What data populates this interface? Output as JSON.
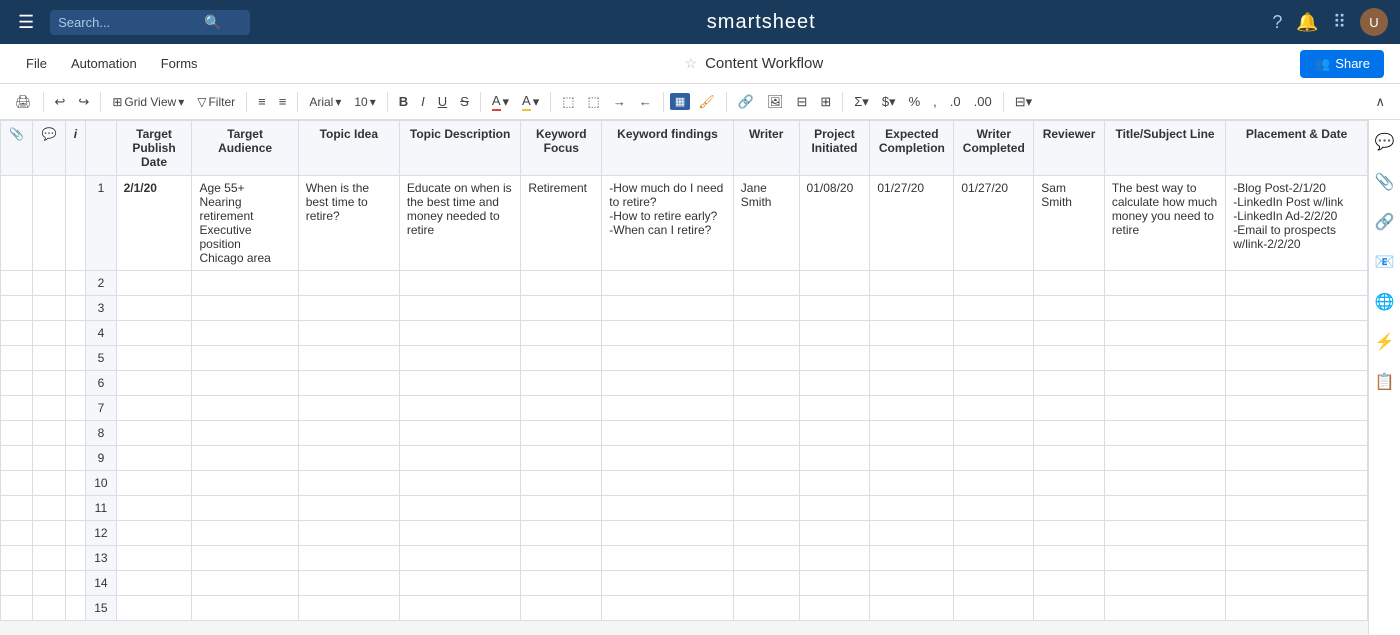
{
  "nav": {
    "search_placeholder": "Search...",
    "title": "smartsheet",
    "icons": [
      "?",
      "🔔",
      "⠿"
    ],
    "hamburger": "☰"
  },
  "second_bar": {
    "menu_items": [
      "File",
      "Automation",
      "Forms"
    ],
    "sheet_title": "Content Workflow",
    "share_label": "Share"
  },
  "toolbar": {
    "grid_view_label": "Grid View",
    "filter_label": "Filter",
    "font_label": "Arial",
    "size_label": "10",
    "bold": "B",
    "italic": "I",
    "underline": "U",
    "strikethrough": "S"
  },
  "columns": [
    {
      "id": "target_publish_date",
      "label": "Target Publish Date"
    },
    {
      "id": "target_audience",
      "label": "Target Audience"
    },
    {
      "id": "topic_idea",
      "label": "Topic Idea"
    },
    {
      "id": "topic_description",
      "label": "Topic Description"
    },
    {
      "id": "keyword_focus",
      "label": "Keyword Focus"
    },
    {
      "id": "keyword_findings",
      "label": "Keyword findings"
    },
    {
      "id": "writer",
      "label": "Writer"
    },
    {
      "id": "project_initiated",
      "label": "Project Initiated"
    },
    {
      "id": "expected_completion",
      "label": "Expected Completion"
    },
    {
      "id": "writer_completed",
      "label": "Writer Completed"
    },
    {
      "id": "reviewer",
      "label": "Reviewer"
    },
    {
      "id": "title_subject",
      "label": "Title/Subject Line"
    },
    {
      "id": "placement_date",
      "label": "Placement & Date"
    }
  ],
  "rows": [
    {
      "num": 1,
      "target_publish_date": "2/1/20",
      "target_audience": "Age 55+\nNearing retirement\nExecutive position\nChicago area",
      "topic_idea": "When is the best time to retire?",
      "topic_description": "Educate on when is the best time and money needed to retire",
      "keyword_focus": "Retirement",
      "keyword_findings": "-How much do I need to retire?\n-How to retire early?\n-When can I retire?",
      "writer": "Jane Smith",
      "project_initiated": "01/08/20",
      "expected_completion": "01/27/20",
      "writer_completed": "01/27/20",
      "reviewer": "Sam Smith",
      "title_subject": "The best way to calculate how much money you need to retire",
      "placement_date": "-Blog Post-2/1/20\n-LinkedIn Post w/link\n-LinkedIn Ad-2/2/20\n-Email to prospects w/link-2/2/20"
    },
    {
      "num": 2,
      "target_publish_date": "",
      "target_audience": "",
      "topic_idea": "",
      "topic_description": "",
      "keyword_focus": "",
      "keyword_findings": "",
      "writer": "",
      "project_initiated": "",
      "expected_completion": "",
      "writer_completed": "",
      "reviewer": "",
      "title_subject": "",
      "placement_date": ""
    },
    {
      "num": 3,
      "target_publish_date": "",
      "target_audience": "",
      "topic_idea": "",
      "topic_description": "",
      "keyword_focus": "",
      "keyword_findings": "",
      "writer": "",
      "project_initiated": "",
      "expected_completion": "",
      "writer_completed": "",
      "reviewer": "",
      "title_subject": "",
      "placement_date": ""
    },
    {
      "num": 4,
      "target_publish_date": "",
      "target_audience": "",
      "topic_idea": "",
      "topic_description": "",
      "keyword_focus": "",
      "keyword_findings": "",
      "writer": "",
      "project_initiated": "",
      "expected_completion": "",
      "writer_completed": "",
      "reviewer": "",
      "title_subject": "",
      "placement_date": ""
    },
    {
      "num": 5,
      "target_publish_date": "",
      "target_audience": "",
      "topic_idea": "",
      "topic_description": "",
      "keyword_focus": "",
      "keyword_findings": "",
      "writer": "",
      "project_initiated": "",
      "expected_completion": "",
      "writer_completed": "",
      "reviewer": "",
      "title_subject": "",
      "placement_date": ""
    },
    {
      "num": 6,
      "target_publish_date": "",
      "target_audience": "",
      "topic_idea": "",
      "topic_description": "",
      "keyword_focus": "",
      "keyword_findings": "",
      "writer": "",
      "project_initiated": "",
      "expected_completion": "",
      "writer_completed": "",
      "reviewer": "",
      "title_subject": "",
      "placement_date": ""
    },
    {
      "num": 7,
      "target_publish_date": "",
      "target_audience": "",
      "topic_idea": "",
      "topic_description": "",
      "keyword_focus": "",
      "keyword_findings": "",
      "writer": "",
      "project_initiated": "",
      "expected_completion": "",
      "writer_completed": "",
      "reviewer": "",
      "title_subject": "",
      "placement_date": ""
    },
    {
      "num": 8,
      "target_publish_date": "",
      "target_audience": "",
      "topic_idea": "",
      "topic_description": "",
      "keyword_focus": "",
      "keyword_findings": "",
      "writer": "",
      "project_initiated": "",
      "expected_completion": "",
      "writer_completed": "",
      "reviewer": "",
      "title_subject": "",
      "placement_date": ""
    },
    {
      "num": 9,
      "target_publish_date": "",
      "target_audience": "",
      "topic_idea": "",
      "topic_description": "",
      "keyword_focus": "",
      "keyword_findings": "",
      "writer": "",
      "project_initiated": "",
      "expected_completion": "",
      "writer_completed": "",
      "reviewer": "",
      "title_subject": "",
      "placement_date": ""
    },
    {
      "num": 10,
      "target_publish_date": "",
      "target_audience": "",
      "topic_idea": "",
      "topic_description": "",
      "keyword_focus": "",
      "keyword_findings": "",
      "writer": "",
      "project_initiated": "",
      "expected_completion": "",
      "writer_completed": "",
      "reviewer": "",
      "title_subject": "",
      "placement_date": ""
    },
    {
      "num": 11,
      "target_publish_date": "",
      "target_audience": "",
      "topic_idea": "",
      "topic_description": "",
      "keyword_focus": "",
      "keyword_findings": "",
      "writer": "",
      "project_initiated": "",
      "expected_completion": "",
      "writer_completed": "",
      "reviewer": "",
      "title_subject": "",
      "placement_date": ""
    },
    {
      "num": 12,
      "target_publish_date": "",
      "target_audience": "",
      "topic_idea": "",
      "topic_description": "",
      "keyword_focus": "",
      "keyword_findings": "",
      "writer": "",
      "project_initiated": "",
      "expected_completion": "",
      "writer_completed": "",
      "reviewer": "",
      "title_subject": "",
      "placement_date": ""
    },
    {
      "num": 13,
      "target_publish_date": "",
      "target_audience": "",
      "topic_idea": "",
      "topic_description": "",
      "keyword_focus": "",
      "keyword_findings": "",
      "writer": "",
      "project_initiated": "",
      "expected_completion": "",
      "writer_completed": "",
      "reviewer": "",
      "title_subject": "",
      "placement_date": ""
    },
    {
      "num": 14,
      "target_publish_date": "",
      "target_audience": "",
      "topic_idea": "",
      "topic_description": "",
      "keyword_focus": "",
      "keyword_findings": "",
      "writer": "",
      "project_initiated": "",
      "expected_completion": "",
      "writer_completed": "",
      "reviewer": "",
      "title_subject": "",
      "placement_date": ""
    },
    {
      "num": 15,
      "target_publish_date": "",
      "target_audience": "",
      "topic_idea": "",
      "topic_description": "",
      "keyword_focus": "",
      "keyword_findings": "",
      "writer": "",
      "project_initiated": "",
      "expected_completion": "",
      "writer_completed": "",
      "reviewer": "",
      "title_subject": "",
      "placement_date": ""
    }
  ],
  "right_sidebar_icons": [
    "💬",
    "📎",
    "🔗",
    "📧",
    "🌐",
    "⚡",
    "📋"
  ]
}
